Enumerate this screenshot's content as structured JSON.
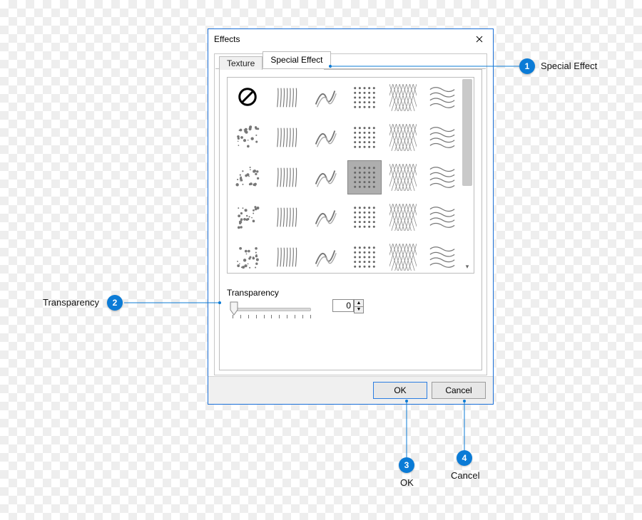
{
  "dialog": {
    "title": "Effects",
    "tabs": [
      {
        "id": "texture",
        "label": "Texture",
        "active": false
      },
      {
        "id": "special",
        "label": "Special Effect",
        "active": true
      }
    ],
    "transparency_label": "Transparency",
    "transparency_value": "0",
    "ok_label": "OK",
    "cancel_label": "Cancel",
    "selected_effect_index": 15,
    "effect_count": 30
  },
  "callouts": {
    "c1": {
      "num": "1",
      "label": "Special Effect"
    },
    "c2": {
      "num": "2",
      "label": "Transparency"
    },
    "c3": {
      "num": "3",
      "label": "OK"
    },
    "c4": {
      "num": "4",
      "label": "Cancel"
    }
  }
}
